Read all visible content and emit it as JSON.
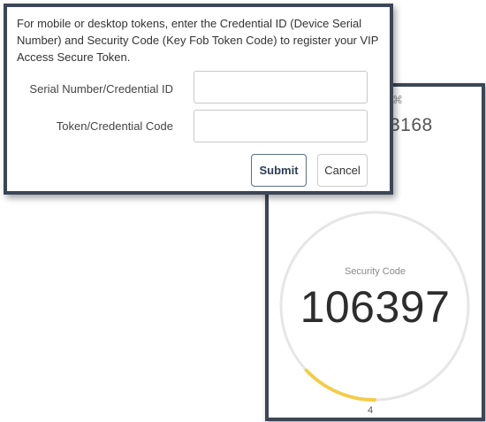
{
  "dialog": {
    "intro_text": "For mobile or desktop tokens, enter the Credential ID (Device Serial Number) and Security Code (Key Fob Token Code) to register your VIP Access Secure Token.",
    "serial_label": "Serial Number/Credential ID",
    "serial_value": "",
    "token_label": "Token/Credential Code",
    "token_value": "",
    "submit_label": "Submit",
    "cancel_label": "Cancel"
  },
  "token_app": {
    "credential_fragment": "3168",
    "security_label": "Security Code",
    "security_code": "106397",
    "countdown": "4",
    "countdown_fraction": 0.13,
    "ring_track_color": "#e6e6e6",
    "ring_progress_color": "#f2cd4a"
  }
}
